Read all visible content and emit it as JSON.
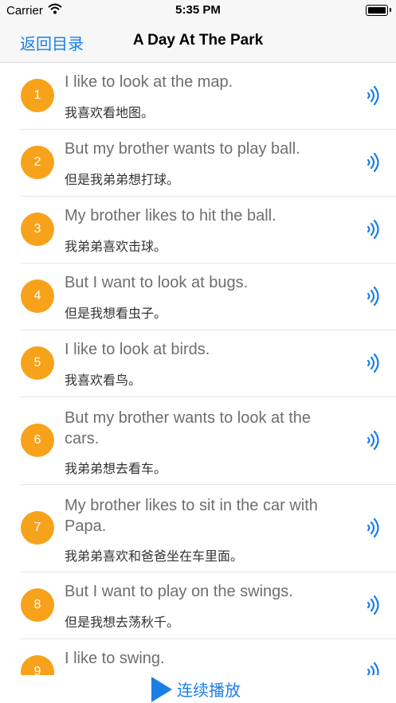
{
  "status": {
    "carrier": "Carrier",
    "time": "5:35 PM"
  },
  "nav": {
    "back_label": "返回目录",
    "title": "A Day At The Park"
  },
  "accent_color": "#1a7fe6",
  "badge_color": "#f7a21b",
  "rows": [
    {
      "num": "1",
      "en": "I like to look at the map.",
      "cn": "我喜欢看地图。"
    },
    {
      "num": "2",
      "en": "But my brother wants to play ball.",
      "cn": "但是我弟弟想打球。"
    },
    {
      "num": "3",
      "en": "My brother likes to hit the ball.",
      "cn": "我弟弟喜欢击球。"
    },
    {
      "num": "4",
      "en": "But I want to look at bugs.",
      "cn": "但是我想看虫子。"
    },
    {
      "num": "5",
      "en": "I like to look at birds.",
      "cn": "我喜欢看鸟。"
    },
    {
      "num": "6",
      "en": "But my brother wants to look at the cars.",
      "cn": "我弟弟想去看车。"
    },
    {
      "num": "7",
      "en": "My brother likes to sit in the car with Papa.",
      "cn": "我弟弟喜欢和爸爸坐在车里面。"
    },
    {
      "num": "8",
      "en": "But I want to play on the swings.",
      "cn": "但是我想去荡秋千。"
    },
    {
      "num": "9",
      "en": "I like to swing.",
      "cn": ""
    }
  ],
  "bottom": {
    "play_all_label": "连续播放",
    "play_icon": "play-icon"
  }
}
